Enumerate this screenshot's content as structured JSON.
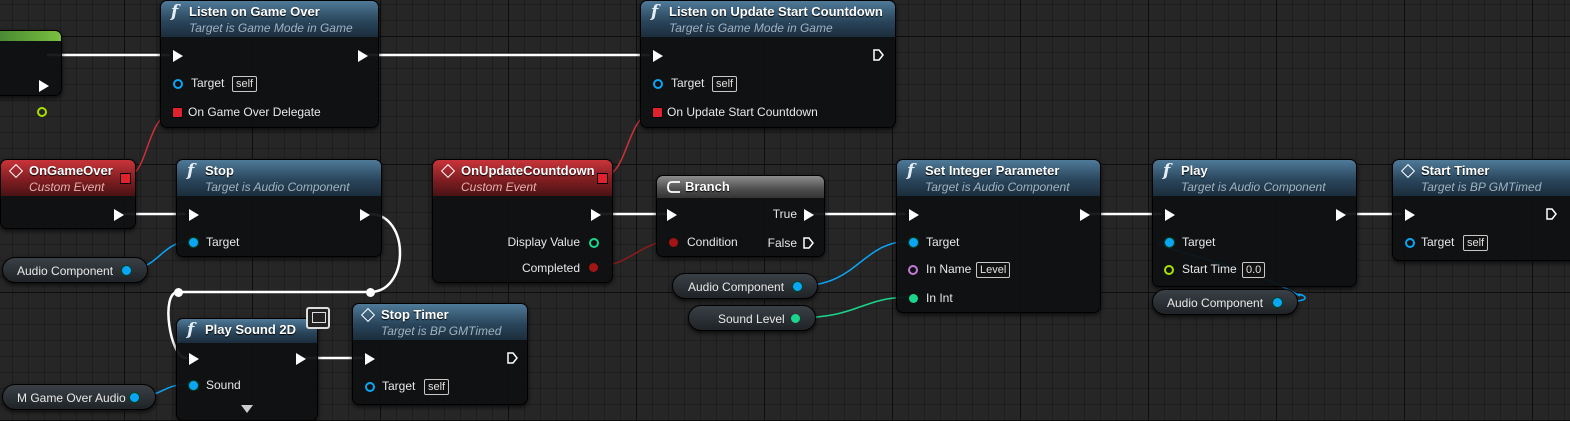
{
  "nodes": {
    "listen_game_over": {
      "title": "Listen on Game Over",
      "subtitle": "Target is Game Mode in Game",
      "target_label": "Target",
      "target_value": "self",
      "delegate_label": "On Game Over Delegate"
    },
    "listen_countdown": {
      "title": "Listen on Update Start Countdown",
      "subtitle": "Target is Game Mode in Game",
      "target_label": "Target",
      "target_value": "self",
      "delegate_label": "On Update Start Countdown"
    },
    "on_game_over": {
      "title": "OnGameOver",
      "subtitle": "Custom Event"
    },
    "stop": {
      "title": "Stop",
      "subtitle": "Target is Audio Component",
      "target_label": "Target"
    },
    "on_update_countdown": {
      "title": "OnUpdateCountdown",
      "subtitle": "Custom Event",
      "out1": "Display Value",
      "out2": "Completed"
    },
    "branch": {
      "title": "Branch",
      "true_label": "True",
      "false_label": "False",
      "condition_label": "Condition"
    },
    "set_integer": {
      "title": "Set Integer Parameter",
      "subtitle": "Target is Audio Component",
      "target_label": "Target",
      "inname_label": "In Name",
      "inname_value": "Level",
      "inint_label": "In Int"
    },
    "play": {
      "title": "Play",
      "subtitle": "Target is Audio Component",
      "target_label": "Target",
      "start_time_label": "Start Time",
      "start_time_value": "0.0"
    },
    "start_timer": {
      "title": "Start Timer",
      "subtitle": "Target is BP GMTimed",
      "target_label": "Target",
      "target_value": "self"
    },
    "play_sound_2d": {
      "title": "Play Sound 2D",
      "sound_label": "Sound"
    },
    "stop_timer": {
      "title": "Stop Timer",
      "subtitle": "Target is BP GMTimed",
      "target_label": "Target",
      "target_value": "self"
    }
  },
  "variables": {
    "audio_component_1": "Audio Component",
    "audio_component_2": "Audio Component",
    "audio_component_3": "Audio Component",
    "sound_level": "Sound Level",
    "m_game_over_audio": "M Game Over Audio"
  },
  "colors": {
    "exec": "#ffffff",
    "object": "#0ba5f5",
    "delegate": "#e0222c",
    "integer": "#1ad68a",
    "name": "#c47ad9",
    "float": "#a8e000",
    "bool": "#a31414"
  }
}
